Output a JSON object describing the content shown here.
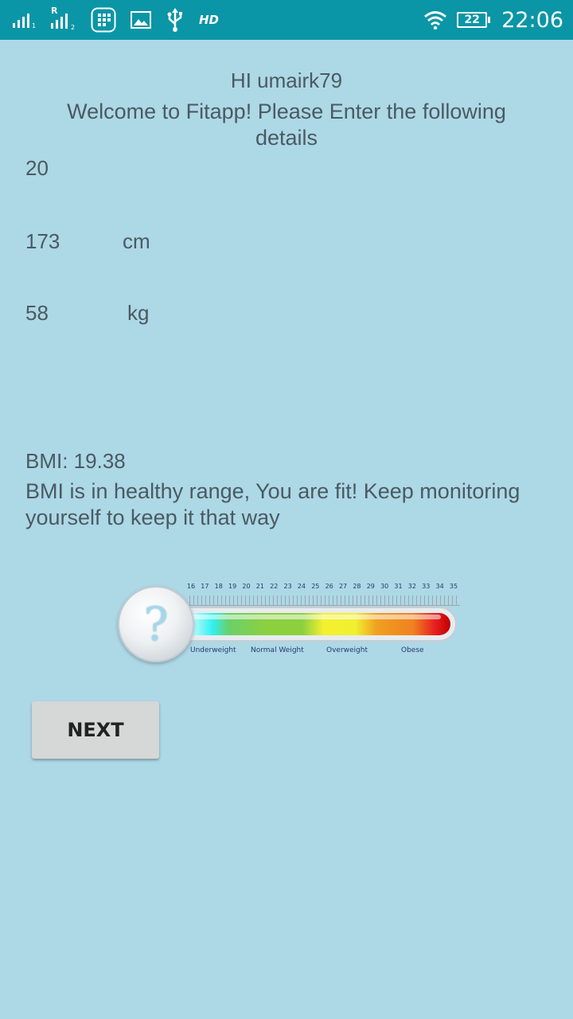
{
  "status_bar": {
    "sim2_label": "R",
    "hd_label": "HD",
    "battery_level": "22",
    "time": "22:06",
    "icons": [
      "signal-sim1-icon",
      "signal-sim2-icon",
      "app-notification-icon",
      "image-notification-icon",
      "usb-icon",
      "hd-icon",
      "wifi-icon",
      "battery-icon"
    ]
  },
  "header": {
    "greeting": "HI umairk79",
    "welcome": "Welcome to Fitapp! Please Enter the following details"
  },
  "form": {
    "age": "20",
    "height": "173",
    "height_unit": "cm",
    "weight": "58",
    "weight_unit": "kg"
  },
  "bmi": {
    "value_text": "BMI: 19.38",
    "message": "BMI is in healthy range, You are fit! Keep monitoring yourself to keep it that way"
  },
  "bmi_scale": {
    "ticks": [
      "16",
      "17",
      "18",
      "19",
      "20",
      "21",
      "22",
      "23",
      "24",
      "25",
      "26",
      "27",
      "28",
      "29",
      "30",
      "31",
      "32",
      "33",
      "34",
      "35"
    ],
    "ranges": [
      "Underweight",
      "Normal Weight",
      "Overweight",
      "Obese"
    ],
    "indicator_symbol": "?"
  },
  "actions": {
    "next_label": "NEXT"
  }
}
